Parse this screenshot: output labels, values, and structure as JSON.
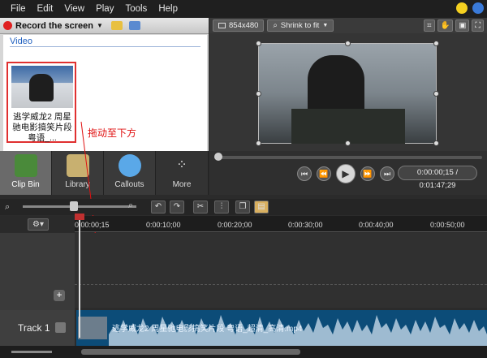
{
  "menu": {
    "items": [
      "File",
      "Edit",
      "View",
      "Play",
      "Tools",
      "Help"
    ]
  },
  "left_toolbar": {
    "record_label": "Record the screen"
  },
  "clip_bin": {
    "section_title": "Video",
    "clip": {
      "caption": "逃学威龙2 周星驰电影搞笑片段 粤语_..."
    }
  },
  "tabs": [
    {
      "label": "Clip Bin"
    },
    {
      "label": "Library"
    },
    {
      "label": "Callouts"
    },
    {
      "label": "More"
    }
  ],
  "annotation": "拖动至下方",
  "preview": {
    "dimensions": "854x480",
    "fit_mode": "Shrink to fit"
  },
  "player": {
    "time_display": "0:00:00;15 / 0:01:47;29",
    "progress": 0.0
  },
  "timeline": {
    "ticks": [
      "0:00:00;15",
      "0:00:10;00",
      "0:00:20;00",
      "0:00:30;00",
      "0:00:40;00",
      "0:00:50;00"
    ],
    "track_label": "Track 1",
    "clip_name": "逃学威龙2 周星驰电影搞笑片段 粤语_超清_高清.mp4"
  },
  "colors": {
    "annotation": "#e01010",
    "clip_border": "#e03030",
    "track_clip": "#0c4c78"
  }
}
